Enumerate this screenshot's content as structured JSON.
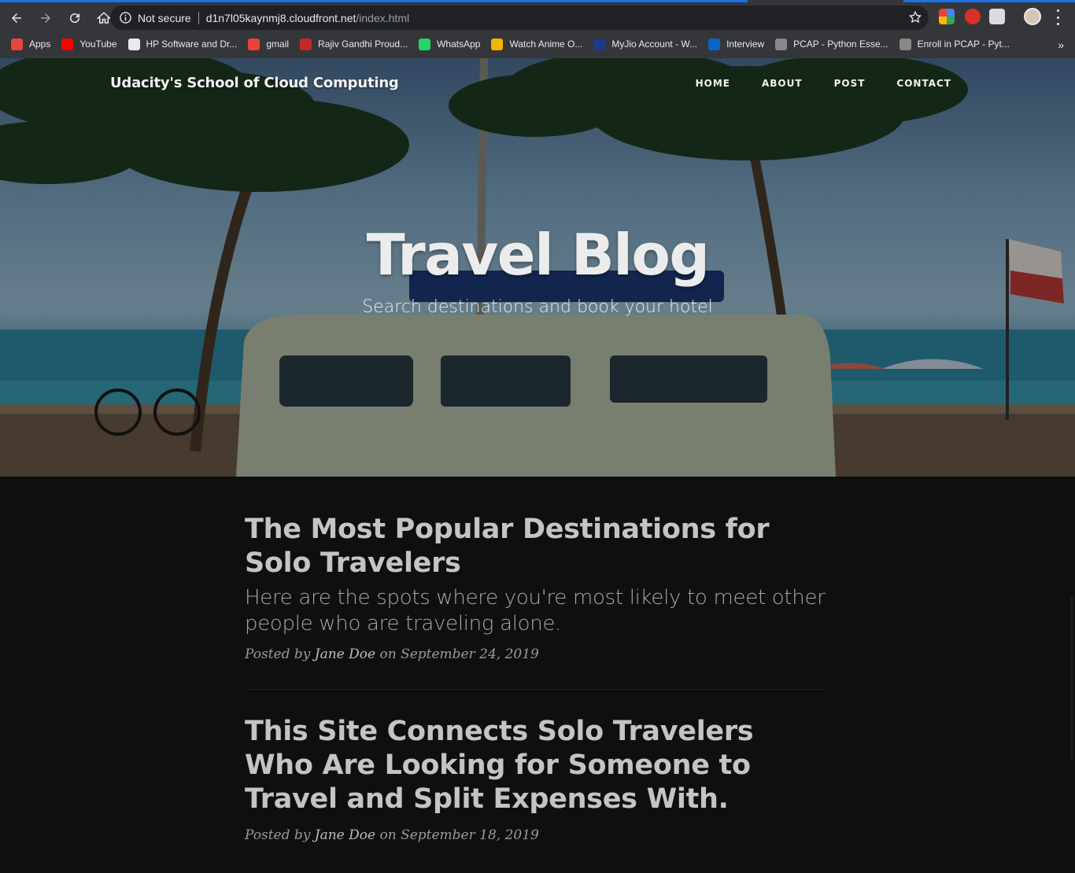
{
  "browser": {
    "security_label": "Not secure",
    "url_host": "d1n7l05kaynmj8.cloudfront.net",
    "url_path": "/index.html",
    "bookmarks": [
      {
        "label": "Apps",
        "icon": "apps-grid-icon",
        "color": "#e8453c"
      },
      {
        "label": "YouTube",
        "icon": "youtube-icon",
        "color": "#ff0000"
      },
      {
        "label": "HP Software and Dr...",
        "icon": "hp-icon",
        "color": "#e8eaed"
      },
      {
        "label": "gmail",
        "icon": "gmail-icon",
        "color": "#ea4335"
      },
      {
        "label": "Rajiv Gandhi Proud...",
        "icon": "site-icon",
        "color": "#c62828"
      },
      {
        "label": "WhatsApp",
        "icon": "whatsapp-icon",
        "color": "#25d366"
      },
      {
        "label": "Watch Anime O...",
        "icon": "crown-icon",
        "color": "#f4b400"
      },
      {
        "label": "MyJio Account - W...",
        "icon": "jio-icon",
        "color": "#1e3a8a"
      },
      {
        "label": "Interview",
        "icon": "linkedin-icon",
        "color": "#0a66c2"
      },
      {
        "label": "PCAP - Python Esse...",
        "icon": "cisco-icon",
        "color": "#888888"
      },
      {
        "label": "Enroll in PCAP - Pyt...",
        "icon": "cisco-icon",
        "color": "#888888"
      }
    ],
    "more_bookmarks": "»"
  },
  "site": {
    "brand": "Udacity's School of Cloud Computing",
    "nav": [
      "HOME",
      "ABOUT",
      "POST",
      "CONTACT"
    ],
    "hero_title": "Travel Blog",
    "hero_subtitle": "Search destinations and book your hotel"
  },
  "posts": [
    {
      "title": "The Most Popular Destinations for Solo Travelers",
      "subtitle": "Here are the spots where you're most likely to meet other people who are traveling alone.",
      "posted_by": "Posted by",
      "author": "Jane Doe",
      "on": "on",
      "date": "September 24, 2019"
    },
    {
      "title": "This Site Connects Solo Travelers Who Are Looking for Someone to Travel and Split Expenses With.",
      "posted_by": "Posted by",
      "author": "Jane Doe",
      "on": "on",
      "date": "September 18, 2019"
    }
  ]
}
